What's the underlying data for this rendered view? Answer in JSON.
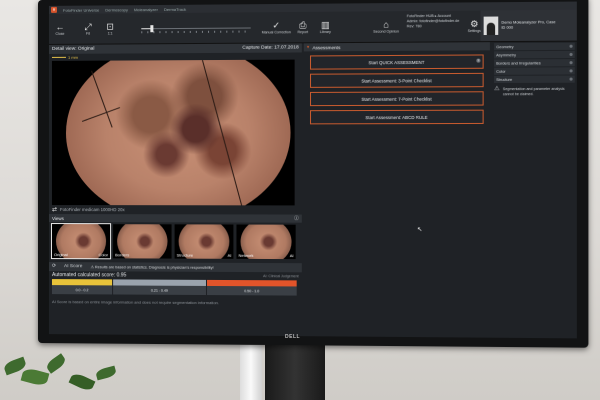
{
  "app": {
    "window_title": "FotoFinder Universe",
    "badge": "ff",
    "tabs": [
      "Dermoscopy",
      "Moleanalyzer",
      "DermaTrack"
    ]
  },
  "toolbar": {
    "close_label": "Close",
    "fit_label": "Fit",
    "zoom_label": "1:1",
    "zoom_value": 0.08,
    "manual_correction_label": "Manual Correction",
    "report_label": "Report",
    "library_label": "Library",
    "second_opinion_label": "Second Opinion",
    "settings_label": "Settings"
  },
  "account": {
    "line1": "FotoFinder HUB ▸",
    "line1b": "Account",
    "line2": "Admin: fotofinder@fotofinder.de",
    "line3": "Rev: 780"
  },
  "patient": {
    "name": "Demo Moleanalyzer Pro, Case",
    "id": "ID 000"
  },
  "detail": {
    "title": "Detail view: Original",
    "capture_date": "Capture Date: 17.07.2018",
    "scale_label": "1 mm",
    "camera": "FotoFinder medicam 1000HD 20x"
  },
  "views": {
    "title": "Views",
    "items": [
      {
        "label": "Original",
        "right": "Color"
      },
      {
        "label": "Borders",
        "right": ""
      },
      {
        "label": "Structure",
        "right": "AI"
      },
      {
        "label": "Network",
        "right": "AI"
      }
    ]
  },
  "ai": {
    "title": "AI Score",
    "warning": "Results are based on statistics. Diagnosis is physician's responsibility!",
    "score_label": "Automated calculated score:",
    "score_value": "0.95",
    "clinical_label": "AI: Clinical Judgement",
    "ranges": [
      {
        "text": "0.0 - 0.2",
        "color": "#e8c33a"
      },
      {
        "text": "0.21 - 0.49",
        "color": "#9aa3ad"
      },
      {
        "text": "0.50 - 1.0",
        "color": "#e2542a"
      }
    ],
    "note": "AI Score is based on entire image information and does not require segmentation information."
  },
  "assessments": {
    "title": "Assessments",
    "buttons": [
      "Start QUICK ASSESSMENT",
      "Start Assessment: 3-Point Checklist",
      "Start Assessment: 7-Point Checklist",
      "Start Assessment: ABCD RULE"
    ]
  },
  "sidebar": {
    "items": [
      "Geometry",
      "Asymmetry",
      "Borders and Irregularities",
      "Color",
      "Structure"
    ],
    "warning": "Segmentation and parameter analysis cannot be claimed."
  },
  "monitor": {
    "brand": "DELL"
  },
  "colors": {
    "accent": "#c65a2e",
    "panel": "#2f3338",
    "screen_bg": "#1f2226"
  }
}
